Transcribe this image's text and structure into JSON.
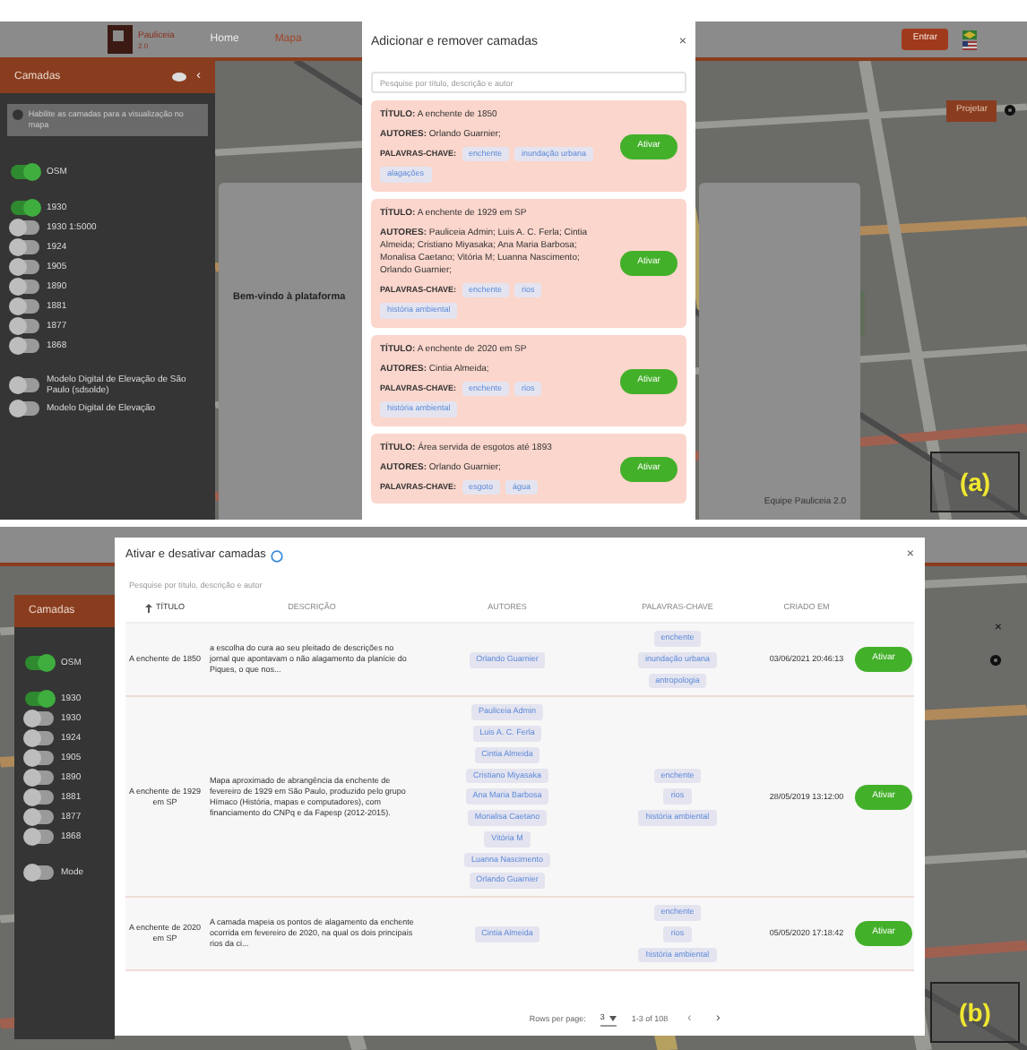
{
  "panel_a": {
    "nav": {
      "logo": "Pauliceia",
      "logo_sub": "2.0",
      "links": [
        {
          "label": "Home",
          "selected": false
        },
        {
          "label": "Mapa",
          "selected": true
        }
      ],
      "login": "Entrar"
    },
    "sidebar": {
      "title": "Camadas",
      "collapse": "‹",
      "hint": "Habilite as camadas para a visualização no mapa",
      "groups": [
        {
          "layers": [
            {
              "label": "OSM",
              "on": true
            }
          ]
        },
        {
          "layers": [
            {
              "label": "1930",
              "on": true
            },
            {
              "label": "1930 1:5000",
              "on": false
            },
            {
              "label": "1924",
              "on": false
            },
            {
              "label": "1905",
              "on": false
            },
            {
              "label": "1890",
              "on": false
            },
            {
              "label": "1881",
              "on": false
            },
            {
              "label": "1877",
              "on": false
            },
            {
              "label": "1868",
              "on": false
            }
          ]
        },
        {
          "layers": [
            {
              "label": "Modelo Digital de Elevação de São Paulo (sdsolde)",
              "on": false
            },
            {
              "label": "Modelo Digital de Elevação",
              "on": false
            }
          ]
        }
      ]
    },
    "project_button": "Projetar",
    "welcome": {
      "title": "Bem-vindo à plataforma",
      "signature": "Equipe Pauliceia 2.0"
    },
    "modal": {
      "title": "Adicionar e remover camadas",
      "close": "×",
      "search_placeholder": "Pesquise por título, descrição e autor",
      "cards": [
        {
          "title_label": "TÍTULO:",
          "title": "A enchente de 1850",
          "authors_label": "AUTORES:",
          "authors": "Orlando Guarnier;",
          "keywords_label": "PALAVRAS-CHAVE:",
          "keywords": [
            "enchente",
            "inundação urbana",
            "alagações"
          ],
          "button": "Ativar"
        },
        {
          "title_label": "TÍTULO:",
          "title": "A enchente de 1929 em SP",
          "authors_label": "AUTORES:",
          "authors": "Pauliceia Admin; Luis A. C. Ferla; Cintia Almeida; Cristiano Miyasaka; Ana Maria Barbosa; Monalisa Caetano; Vitória M; Luanna Nascimento; Orlando Guarnier;",
          "keywords_label": "PALAVRAS-CHAVE:",
          "keywords": [
            "enchente",
            "rios",
            "história ambiental"
          ],
          "button": "Ativar"
        },
        {
          "title_label": "TÍTULO:",
          "title": "A enchente de 2020 em SP",
          "authors_label": "AUTORES:",
          "authors": "Cintia Almeida;",
          "keywords_label": "PALAVRAS-CHAVE:",
          "keywords": [
            "enchente",
            "rios",
            "história ambiental"
          ],
          "button": "Ativar"
        },
        {
          "title_label": "TÍTULO:",
          "title": "Área servida de esgotos até 1893",
          "authors_label": "AUTORES:",
          "authors": "Orlando Guarnier;",
          "keywords_label": "PALAVRAS-CHAVE:",
          "keywords": [
            "esgoto",
            "água"
          ],
          "button": "Ativar"
        }
      ]
    },
    "label": "(a)"
  },
  "panel_b": {
    "sidebar": {
      "title": "Camadas",
      "groups": [
        {
          "layers": [
            {
              "label": "OSM",
              "on": true
            }
          ]
        },
        {
          "layers": [
            {
              "label": "1930",
              "on": true
            },
            {
              "label": "1930",
              "on": false
            },
            {
              "label": "1924",
              "on": false
            },
            {
              "label": "1905",
              "on": false
            },
            {
              "label": "1890",
              "on": false
            },
            {
              "label": "1881",
              "on": false
            },
            {
              "label": "1877",
              "on": false
            },
            {
              "label": "1868",
              "on": false
            }
          ]
        },
        {
          "layers": [
            {
              "label": "Mode",
              "on": false
            }
          ]
        }
      ]
    },
    "modal": {
      "title": "Ativar e desativar camadas",
      "close": "×",
      "search_placeholder": "Pesquise por título, descrição e autor",
      "columns": [
        {
          "label": "TÍTULO",
          "sorted": true
        },
        {
          "label": "DESCRIÇÃO",
          "sorted": false
        },
        {
          "label": "AUTORES",
          "sorted": false
        },
        {
          "label": "PALAVRAS-CHAVE",
          "sorted": false
        },
        {
          "label": "CRIADO EM",
          "sorted": false
        }
      ],
      "rows": [
        {
          "title": "A enchente de 1850",
          "description": "a escolha do cura ao seu pleitado de descrições no jornal que apontavam o não alagamento da planície do Piques, o que nos...",
          "authors": [
            "Orlando Guarnier"
          ],
          "keywords": [
            "enchente",
            "inundação urbana",
            "antropologia"
          ],
          "created": "03/06/2021 20:46:13",
          "button": "Ativar"
        },
        {
          "title": "A enchente de 1929 em SP",
          "description": "Mapa aproximado de abrangência da enchente de fevereiro de 1929 em São Paulo, produzido pelo grupo Hímaco (História, mapas e computadores), com financiamento do CNPq e da Fapesp (2012-2015).",
          "authors": [
            "Pauliceia Admin",
            "Luis A. C. Ferla",
            "Cintia Almeida",
            "Cristiano Miyasaka",
            "Ana Maria Barbosa",
            "Monalisa Caetano",
            "Vitória M",
            "Luanna Nascimento",
            "Orlando Guarnier"
          ],
          "keywords": [
            "enchente",
            "rios",
            "história ambiental"
          ],
          "created": "28/05/2019 13:12:00",
          "button": "Ativar"
        },
        {
          "title": "A enchente de 2020 em SP",
          "description": "A camada mapeia os pontos de alagamento da enchente ocorrida em fevereiro de 2020, na qual os dois principais rios da ci...",
          "authors": [
            "Cintia Almeida"
          ],
          "keywords": [
            "enchente",
            "rios",
            "história ambiental"
          ],
          "created": "05/05/2020 17:18:42",
          "button": "Ativar"
        }
      ],
      "footer": {
        "rows_label": "Rows per page:",
        "rows_value": "3",
        "range": "1-3 of 108",
        "prev": "‹",
        "next": "›"
      }
    },
    "label": "(b)"
  }
}
